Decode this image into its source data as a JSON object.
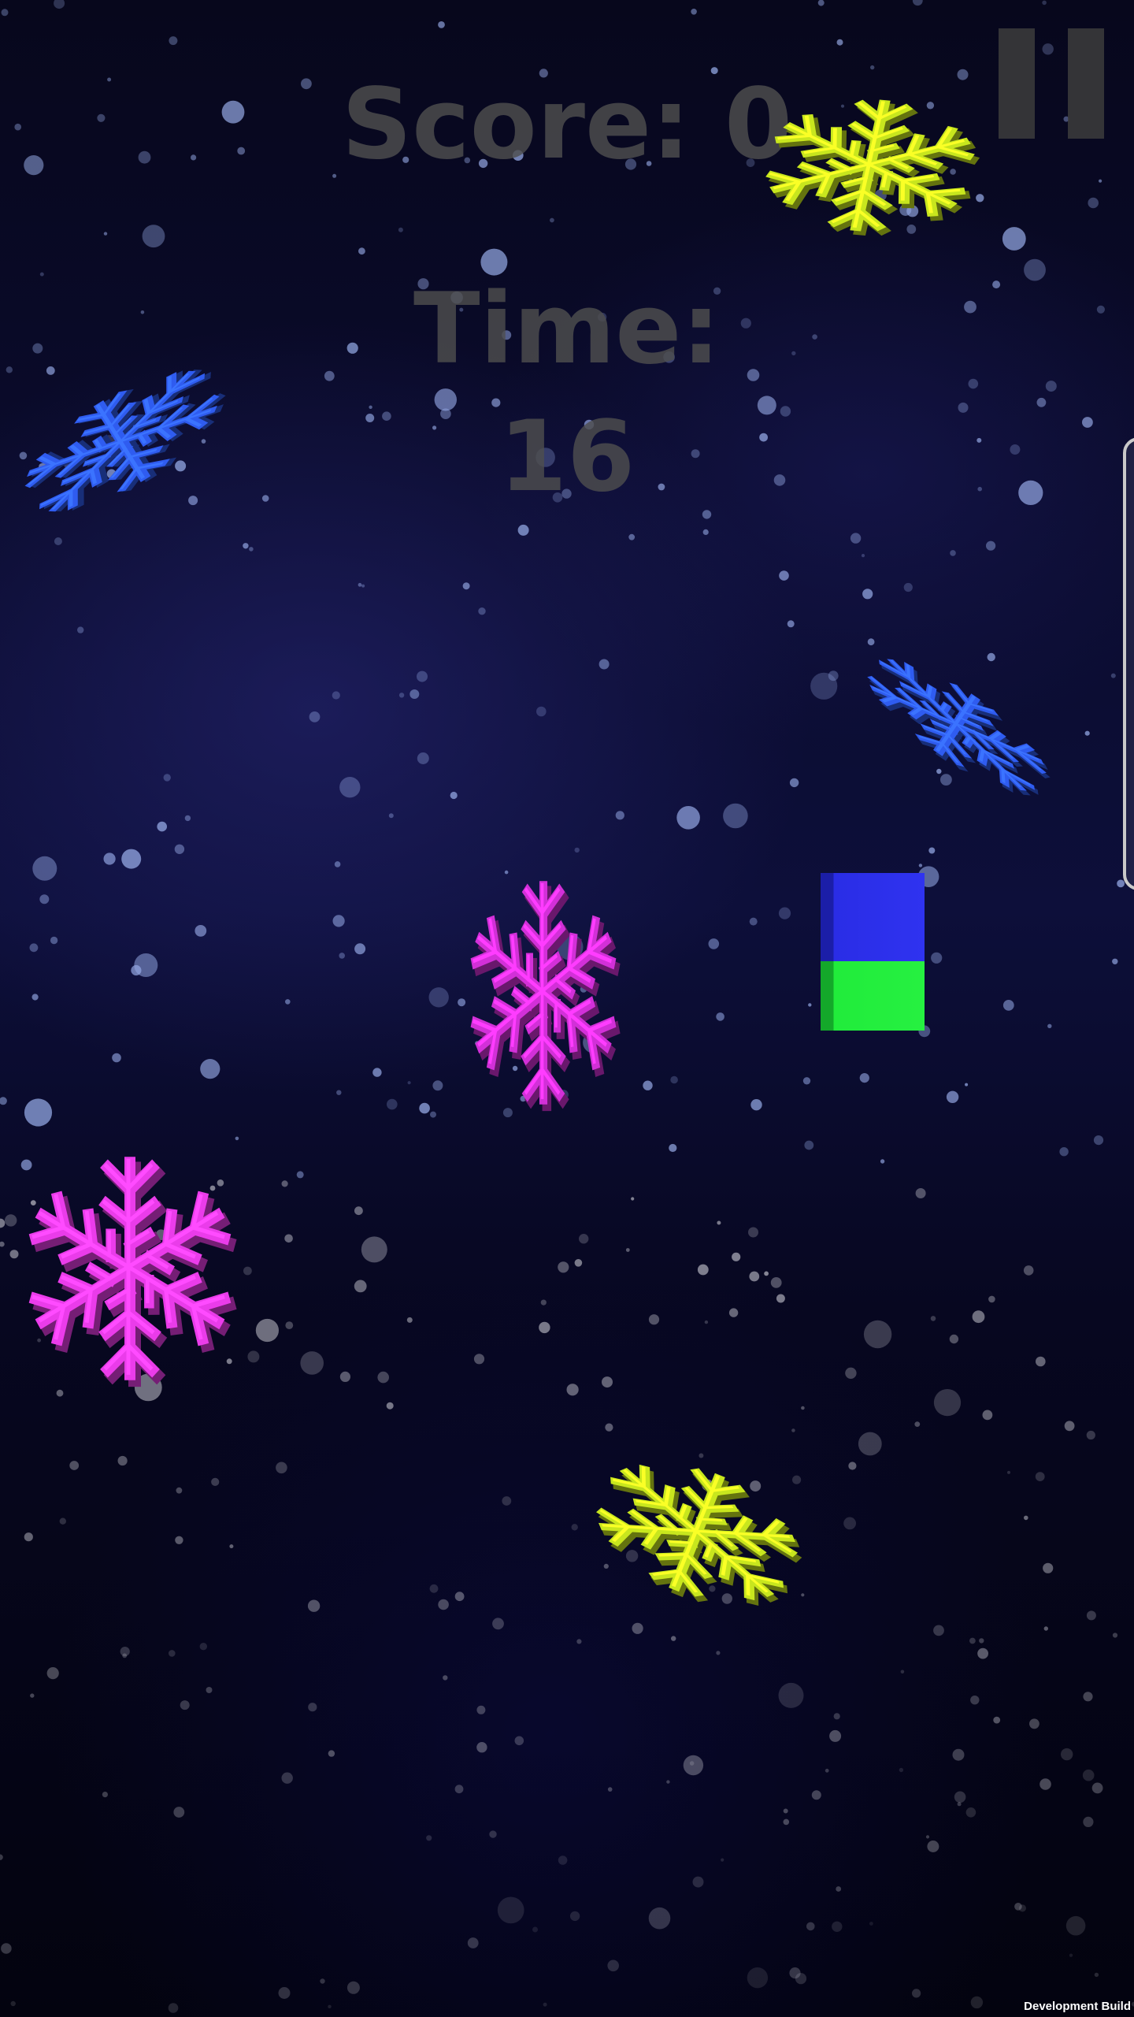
{
  "hud": {
    "score_text": "Score: 0",
    "time_label": "Time:",
    "time_value": "16"
  },
  "pause": {
    "icon": "pause-icon",
    "color": "#3c3c3c"
  },
  "snowflakes": [
    {
      "name": "snowflake-yellow-top-right",
      "color": "#c8e61e",
      "icon": "snowflake-icon"
    },
    {
      "name": "snowflake-blue-top-left",
      "color": "#2f5cf0",
      "icon": "snowflake-icon"
    },
    {
      "name": "snowflake-blue-right",
      "color": "#2f5cf0",
      "icon": "snowflake-icon"
    },
    {
      "name": "snowflake-magenta-center",
      "color": "#d230d8",
      "icon": "snowflake-icon"
    },
    {
      "name": "snowflake-magenta-left",
      "color": "#ea3cea",
      "icon": "snowflake-icon"
    },
    {
      "name": "snowflake-yellow-bottom",
      "color": "#c8e61e",
      "icon": "snowflake-icon"
    }
  ],
  "player": {
    "top_color": "#2f33f0",
    "bottom_color": "#26f041"
  },
  "footer": {
    "build_label": "Development Build"
  }
}
